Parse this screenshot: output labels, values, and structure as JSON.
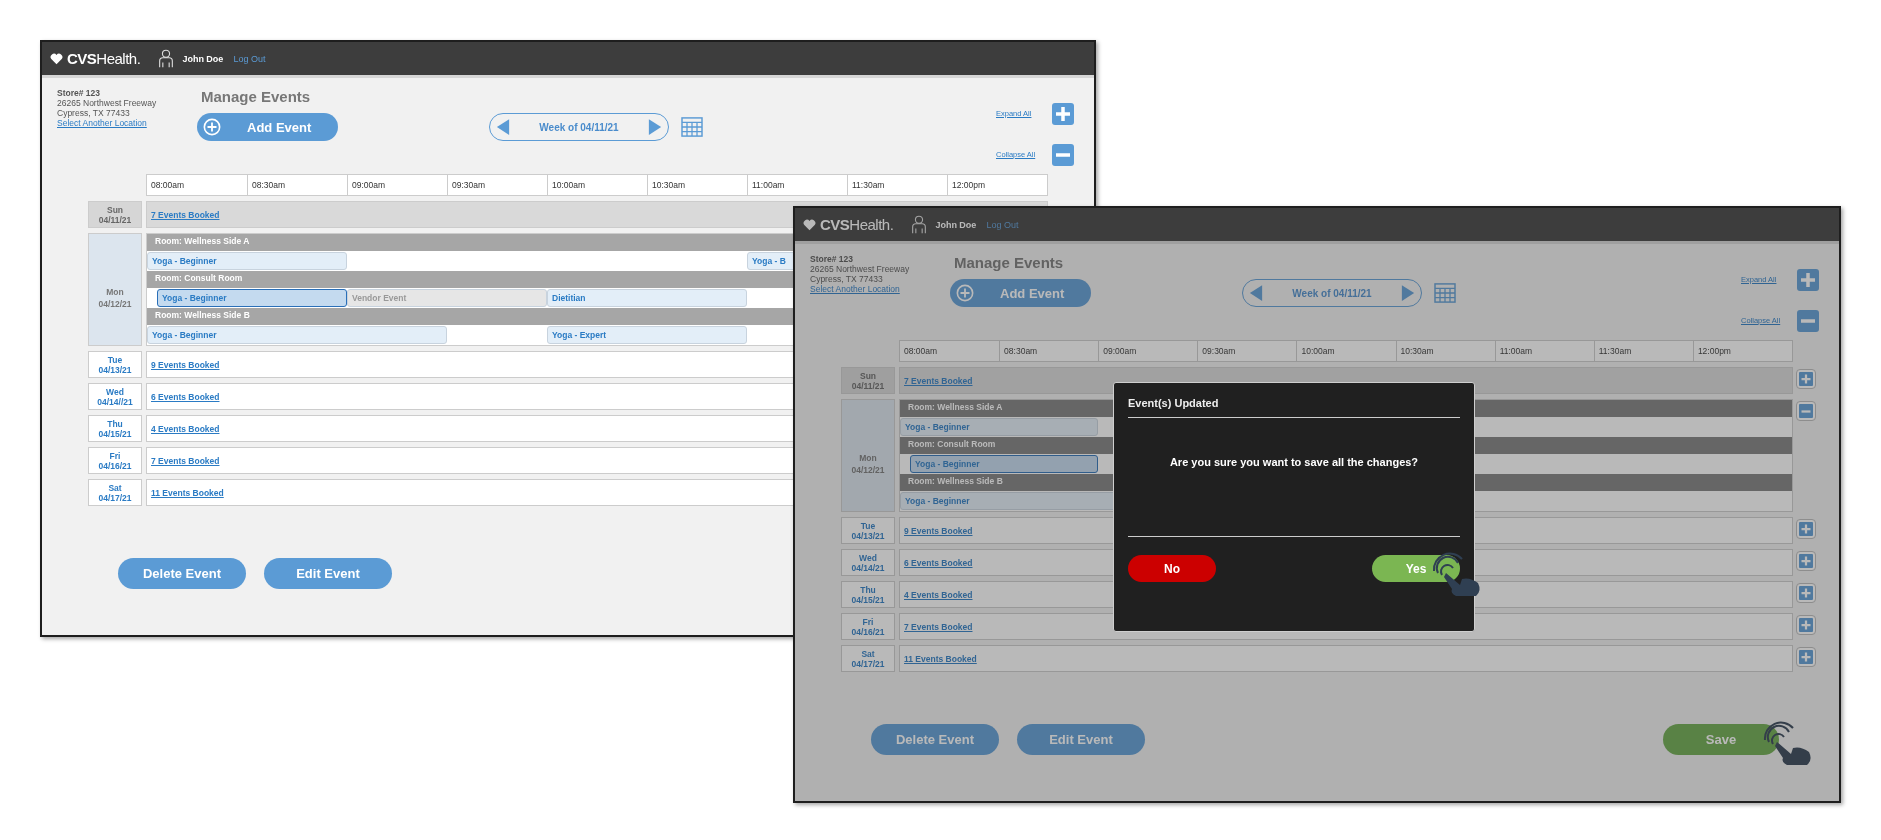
{
  "screens": [
    {
      "header": {
        "logo": "**CVS**Health.",
        "user": "John Doe",
        "logout": "Log Out"
      },
      "store": {
        "number": "Store# 123",
        "street": "26265 Northwest Freeway",
        "city": "Cypress, TX 77433",
        "change_link": "Select Another Location"
      },
      "title": "Manage Events",
      "add_button": "Add Event",
      "week": "Week of 04/11/21",
      "expand_all": "Expand All",
      "collapse_all": "Collapse All",
      "times": [
        "08:00am",
        "08:30am",
        "09:00am",
        "09:30am",
        "10:00am",
        "10:30am",
        "11:00am",
        "11:30am",
        "12:00pm"
      ],
      "days": [
        {
          "day": "Sun",
          "date": "04/11/21",
          "dimmed": true,
          "expanded": false,
          "link": "7 Events Booked"
        },
        {
          "day": "Mon",
          "date": "04/12/21",
          "dimmed": false,
          "expanded": true,
          "rooms": [
            {
              "name": "Room: Wellness Side A",
              "events": [
                {
                  "label": "Yoga - Beginner",
                  "kind": "class",
                  "selected": false
                },
                {
                  "label": "Yoga - B",
                  "kind": "class",
                  "selected": false
                }
              ]
            },
            {
              "name": "Room: Consult Room",
              "events": [
                {
                  "label": "Yoga - Beginner",
                  "kind": "class",
                  "selected": true
                },
                {
                  "label": "Vendor Event",
                  "kind": "vendor",
                  "selected": false
                },
                {
                  "label": "Dietitian",
                  "kind": "class",
                  "selected": false
                }
              ]
            },
            {
              "name": "Room: Wellness Side B",
              "events": [
                {
                  "label": "Yoga - Beginner",
                  "kind": "class",
                  "selected": false
                },
                {
                  "label": "Yoga - Expert",
                  "kind": "class",
                  "selected": false
                }
              ]
            }
          ]
        },
        {
          "day": "Tue",
          "date": "04/13/21",
          "dimmed": false,
          "expanded": false,
          "link": "9 Events Booked"
        },
        {
          "day": "Wed",
          "date": "04/14//21",
          "dimmed": false,
          "expanded": false,
          "link": "6 Events Booked"
        },
        {
          "day": "Thu",
          "date": "04/15/21",
          "dimmed": false,
          "expanded": false,
          "link": "4 Events Booked"
        },
        {
          "day": "Fri",
          "date": "04/16/21",
          "dimmed": false,
          "expanded": false,
          "link": "7 Events Booked"
        },
        {
          "day": "Sat",
          "date": "04/17/21",
          "dimmed": false,
          "expanded": false,
          "link": "11 Events Booked"
        }
      ],
      "actions": [
        {
          "label": "Delete Event",
          "kind": "secondary",
          "tapped": false
        },
        {
          "label": "Edit Event",
          "kind": "secondary",
          "tapped": false
        }
      ]
    },
    {
      "header": {
        "logo": "**CVS**Health.",
        "user": "John Doe",
        "logout": "Log Out"
      },
      "store": {
        "number": "Store# 123",
        "street": "26265 Northwest Freeway",
        "city": "Cypress, TX 77433",
        "change_link": "Select Another Location"
      },
      "title": "Manage Events",
      "add_button": "Add Event",
      "week": "Week of 04/11/21",
      "expand_all": "Expand All",
      "collapse_all": "Collapse All",
      "times": [
        "08:00am",
        "08:30am",
        "09:00am",
        "09:30am",
        "10:00am",
        "10:30am",
        "11:00am",
        "11:30am",
        "12:00pm"
      ],
      "toggles": true,
      "dimmed": true,
      "days": [
        {
          "day": "Sun",
          "date": "04/11/21",
          "dimmed": true,
          "expanded": false,
          "link": "7 Events Booked"
        },
        {
          "day": "Mon",
          "date": "04/12/21",
          "dimmed": false,
          "expanded": true,
          "rooms": [
            {
              "name": "Room: Wellness Side A",
              "events": [
                {
                  "label": "Yoga - Beginner",
                  "kind": "class",
                  "selected": false
                }
              ]
            },
            {
              "name": "Room: Consult Room",
              "events": [
                {
                  "label": "Yoga - Beginner",
                  "kind": "class",
                  "selected": true
                }
              ]
            },
            {
              "name": "Room: Wellness Side B",
              "events": [
                {
                  "label": "Yoga - Beginner",
                  "kind": "class",
                  "selected": false
                }
              ]
            }
          ]
        },
        {
          "day": "Tue",
          "date": "04/13/21",
          "dimmed": false,
          "expanded": false,
          "link": "9 Events Booked"
        },
        {
          "day": "Wed",
          "date": "04/14/21",
          "dimmed": false,
          "expanded": false,
          "link": "6 Events Booked"
        },
        {
          "day": "Thu",
          "date": "04/15/21",
          "dimmed": false,
          "expanded": false,
          "link": "4 Events Booked"
        },
        {
          "day": "Fri",
          "date": "04/16/21",
          "dimmed": false,
          "expanded": false,
          "link": "7 Events Booked"
        },
        {
          "day": "Sat",
          "date": "04/17/21",
          "dimmed": false,
          "expanded": false,
          "link": "11 Events Booked"
        }
      ],
      "actions": [
        {
          "label": "Delete Event",
          "kind": "secondary",
          "tapped": false
        },
        {
          "label": "Edit Event",
          "kind": "secondary",
          "tapped": false
        },
        {
          "label": "Save",
          "kind": "save",
          "tapped": true
        }
      ],
      "dialog": {
        "title": "Event(s) Updated",
        "message": "Are you sure you want to save all the changes?",
        "buttons": [
          {
            "label": "No",
            "kind": "cancel",
            "tapped": false
          },
          {
            "label": "Yes",
            "kind": "confirm",
            "tapped": true
          }
        ]
      }
    }
  ]
}
